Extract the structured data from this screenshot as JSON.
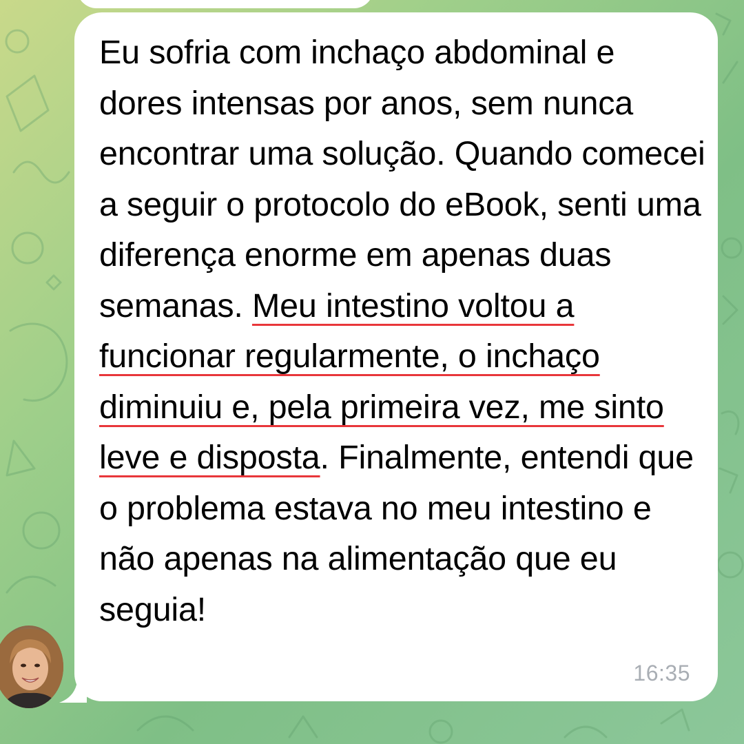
{
  "chat": {
    "message": {
      "segments": [
        {
          "text": "Eu sofria com inchaço abdominal e dores intensas por anos, sem nunca encontrar uma solução. Quando comecei a seguir o protocolo do eBook, senti uma diferença enorme em apenas duas semanas. ",
          "highlighted": false
        },
        {
          "text": "Meu intestino voltou a funcionar regularmente, o inchaço diminuiu e, pela primeira vez, me sinto leve e disposta",
          "highlighted": true
        },
        {
          "text": ". Finalmente, entendi que o problema estava no meu intestino e não apenas na alimentação que eu seguia!",
          "highlighted": false
        }
      ],
      "time": "16:35"
    },
    "avatar_icon": "user-photo-avatar"
  },
  "colors": {
    "bubble": "#ffffff",
    "text": "#000000",
    "underline": "#e8363a",
    "timestamp": "#a9aeb4",
    "wallpaper_start": "#c9d98a",
    "wallpaper_end": "#7fbf86"
  }
}
